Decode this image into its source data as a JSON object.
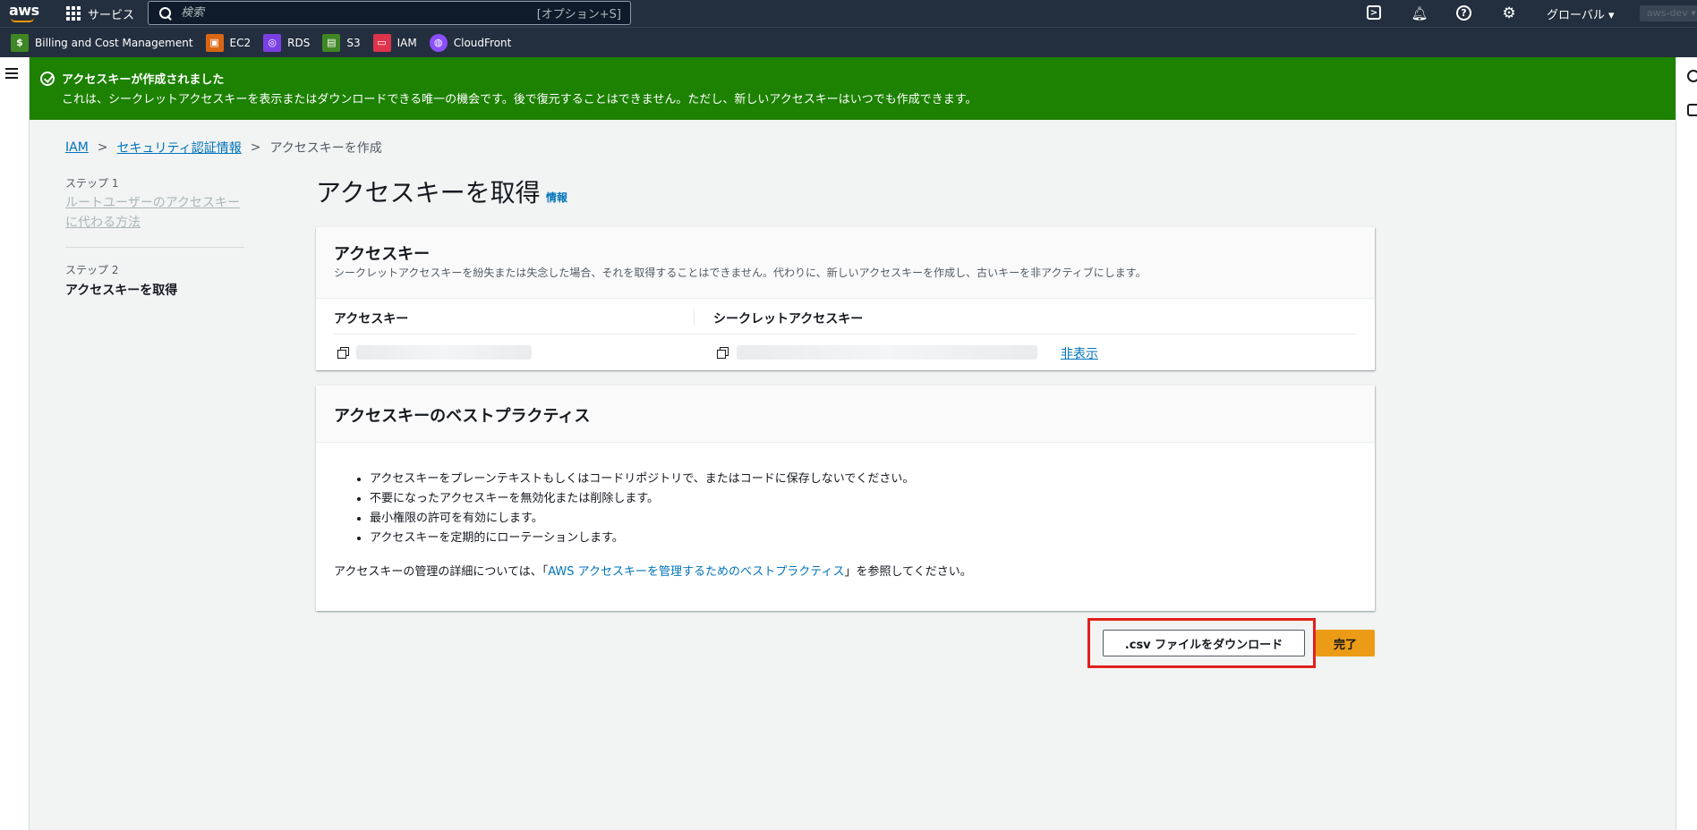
{
  "topnav": {
    "logo_text": "aws",
    "services_label": "サービス",
    "search_placeholder": "検索",
    "search_shortcut": "[オプション+S]",
    "region_label": "グローバル ▾",
    "account_label": "aws-dev ▾"
  },
  "favorites": [
    {
      "label": "Billing and Cost Management",
      "color": "#3f8624",
      "glyph": "$",
      "name": "billing"
    },
    {
      "label": "EC2",
      "color": "#d86613",
      "glyph": "▣",
      "name": "ec2"
    },
    {
      "label": "RDS",
      "color": "#7b3fe4",
      "glyph": "◎",
      "name": "rds"
    },
    {
      "label": "S3",
      "color": "#3f8624",
      "glyph": "▤",
      "name": "s3"
    },
    {
      "label": "IAM",
      "color": "#dd344c",
      "glyph": "▭",
      "name": "iam"
    },
    {
      "label": "CloudFront",
      "color": "#8c4fff",
      "glyph": "◍",
      "name": "cloudfront"
    }
  ],
  "flash": {
    "title": "アクセスキーが作成されました",
    "body": "これは、シークレットアクセスキーを表示またはダウンロードできる唯一の機会です。後で復元することはできません。ただし、新しいアクセスキーはいつでも作成できます。",
    "color": "#1d8102"
  },
  "breadcrumb": {
    "items": [
      "IAM",
      "セキュリティ認証情報"
    ],
    "current": "アクセスキーを作成"
  },
  "steps": {
    "step1_label": "ステップ 1",
    "step1_title": "ルートユーザーのアクセスキーに代わる方法",
    "step2_label": "ステップ 2",
    "step2_title": "アクセスキーを取得"
  },
  "page": {
    "title": "アクセスキーを取得",
    "info": "情報"
  },
  "access_key_panel": {
    "title": "アクセスキー",
    "description": "シークレットアクセスキーを紛失または失念した場合、それを取得することはできません。代わりに、新しいアクセスキーを作成し、古いキーを非アクティブにします。",
    "col_access_key": "アクセスキー",
    "col_secret_key": "シークレットアクセスキー",
    "hide_label": "非表示"
  },
  "best_practices": {
    "title": "アクセスキーのベストプラクティス",
    "items": [
      "アクセスキーをプレーンテキストもしくはコードリポジトリで、またはコードに保存しないでください。",
      "不要になったアクセスキーを無効化または削除します。",
      "最小権限の許可を有効にします。",
      "アクセスキーを定期的にローテーションします。"
    ],
    "note_prefix": "アクセスキーの管理の詳細については、「",
    "note_link": "AWS アクセスキーを管理するためのベストプラクティス",
    "note_suffix": "」を参照してください。"
  },
  "actions": {
    "download_csv": ".csv ファイルをダウンロード",
    "done": "完了"
  }
}
